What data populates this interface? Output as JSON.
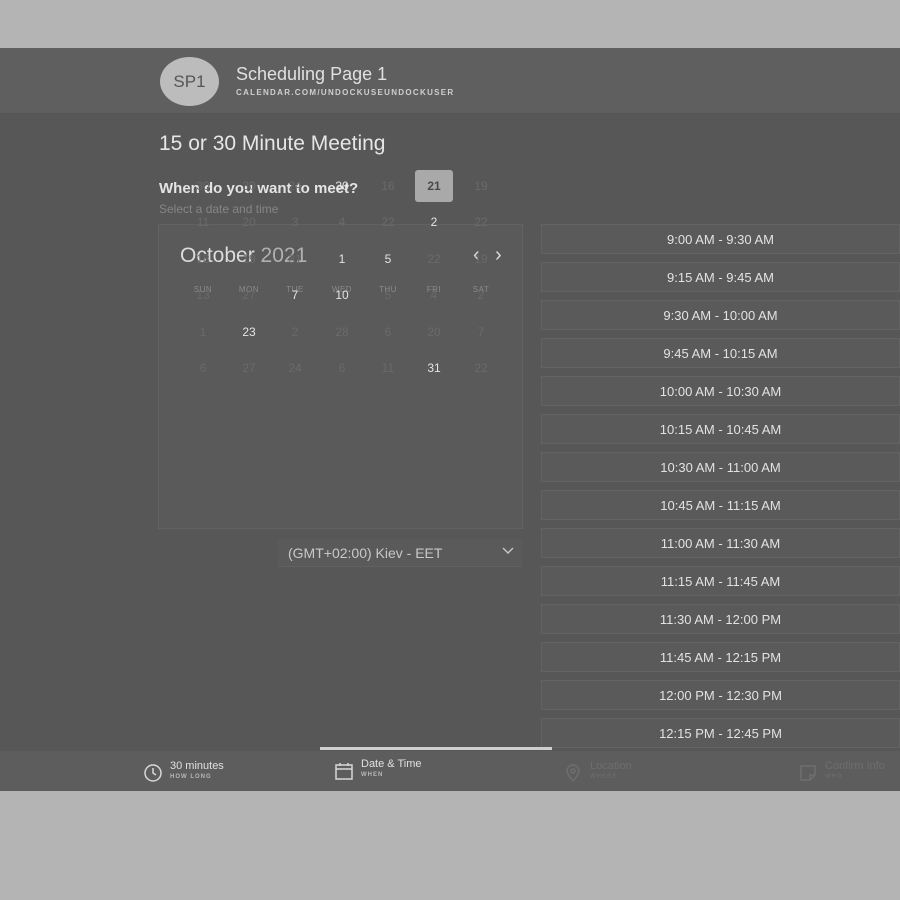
{
  "header": {
    "avatar_initials": "SP1",
    "page_name": "Scheduling Page 1",
    "page_url": "CALENDAR.COM/UNDOCKUSEUNDOCKUSER"
  },
  "meeting": {
    "title": "15 or 30 Minute Meeting",
    "question": "When do you want to meet?",
    "hint": "Select a date and time"
  },
  "calendar": {
    "month": "October",
    "year": "2021",
    "prev_icon": "chevron-left-icon",
    "next_icon": "chevron-right-icon",
    "weekdays": [
      "SUN",
      "MON",
      "TUE",
      "WED",
      "THU",
      "FRI",
      "SAT"
    ],
    "weeks": [
      [
        {
          "d": "30",
          "s": "off"
        },
        {
          "d": "30",
          "s": "off"
        },
        {
          "d": "24",
          "s": "off"
        },
        {
          "d": "30",
          "s": "available"
        },
        {
          "d": "16",
          "s": "off"
        },
        {
          "d": "21",
          "s": "selected"
        },
        {
          "d": "19",
          "s": "off"
        }
      ],
      [
        {
          "d": "11",
          "s": "off"
        },
        {
          "d": "20",
          "s": "off"
        },
        {
          "d": "3",
          "s": "off"
        },
        {
          "d": "4",
          "s": "off"
        },
        {
          "d": "22",
          "s": "off"
        },
        {
          "d": "2",
          "s": "available"
        },
        {
          "d": "22",
          "s": "off"
        }
      ],
      [
        {
          "d": "18",
          "s": "off"
        },
        {
          "d": "19",
          "s": "off"
        },
        {
          "d": "31",
          "s": "off"
        },
        {
          "d": "1",
          "s": "available"
        },
        {
          "d": "5",
          "s": "available"
        },
        {
          "d": "22",
          "s": "off"
        },
        {
          "d": "19",
          "s": "off"
        }
      ],
      [
        {
          "d": "13",
          "s": "off"
        },
        {
          "d": "27",
          "s": "off"
        },
        {
          "d": "7",
          "s": "available"
        },
        {
          "d": "10",
          "s": "available"
        },
        {
          "d": "5",
          "s": "off"
        },
        {
          "d": "4",
          "s": "off"
        },
        {
          "d": "2",
          "s": "off"
        }
      ],
      [
        {
          "d": "1",
          "s": "off"
        },
        {
          "d": "23",
          "s": "available"
        },
        {
          "d": "2",
          "s": "off"
        },
        {
          "d": "28",
          "s": "off"
        },
        {
          "d": "6",
          "s": "off"
        },
        {
          "d": "20",
          "s": "off"
        },
        {
          "d": "7",
          "s": "off"
        }
      ],
      [
        {
          "d": "6",
          "s": "off"
        },
        {
          "d": "27",
          "s": "off"
        },
        {
          "d": "24",
          "s": "off"
        },
        {
          "d": "6",
          "s": "off"
        },
        {
          "d": "11",
          "s": "off"
        },
        {
          "d": "31",
          "s": "available"
        },
        {
          "d": "22",
          "s": "off"
        }
      ]
    ]
  },
  "timezone": {
    "label": "(GMT+02:00) Kiev - EET",
    "icon": "chevron-down-icon"
  },
  "time_slots": [
    "9:00 AM - 9:30 AM",
    "9:15 AM - 9:45 AM",
    "9:30 AM - 10:00 AM",
    "9:45 AM - 10:15 AM",
    "10:00 AM - 10:30 AM",
    "10:15 AM - 10:45 AM",
    "10:30 AM - 11:00 AM",
    "10:45 AM - 11:15 AM",
    "11:00 AM - 11:30 AM",
    "11:15 AM - 11:45 AM",
    "11:30 AM - 12:00 PM",
    "11:45 AM - 12:15 PM",
    "12:00 PM - 12:30 PM",
    "12:15 PM - 12:45 PM"
  ],
  "footer": {
    "steps": [
      {
        "label": "30 minutes",
        "sub": "HOW LONG",
        "icon": "clock-icon",
        "state": "done"
      },
      {
        "label": "Date & Time",
        "sub": "WHEN",
        "icon": "calendar-icon",
        "state": "active"
      },
      {
        "label": "Location",
        "sub": "WHERE",
        "icon": "map-pin-icon",
        "state": "inactive"
      },
      {
        "label": "Confirm Info",
        "sub": "WHO",
        "icon": "note-icon",
        "state": "inactive"
      }
    ]
  },
  "colors": {
    "overlay": "#575757",
    "selected_day": "#a9a9a9",
    "page_backdrop": "#b4b4b4"
  }
}
